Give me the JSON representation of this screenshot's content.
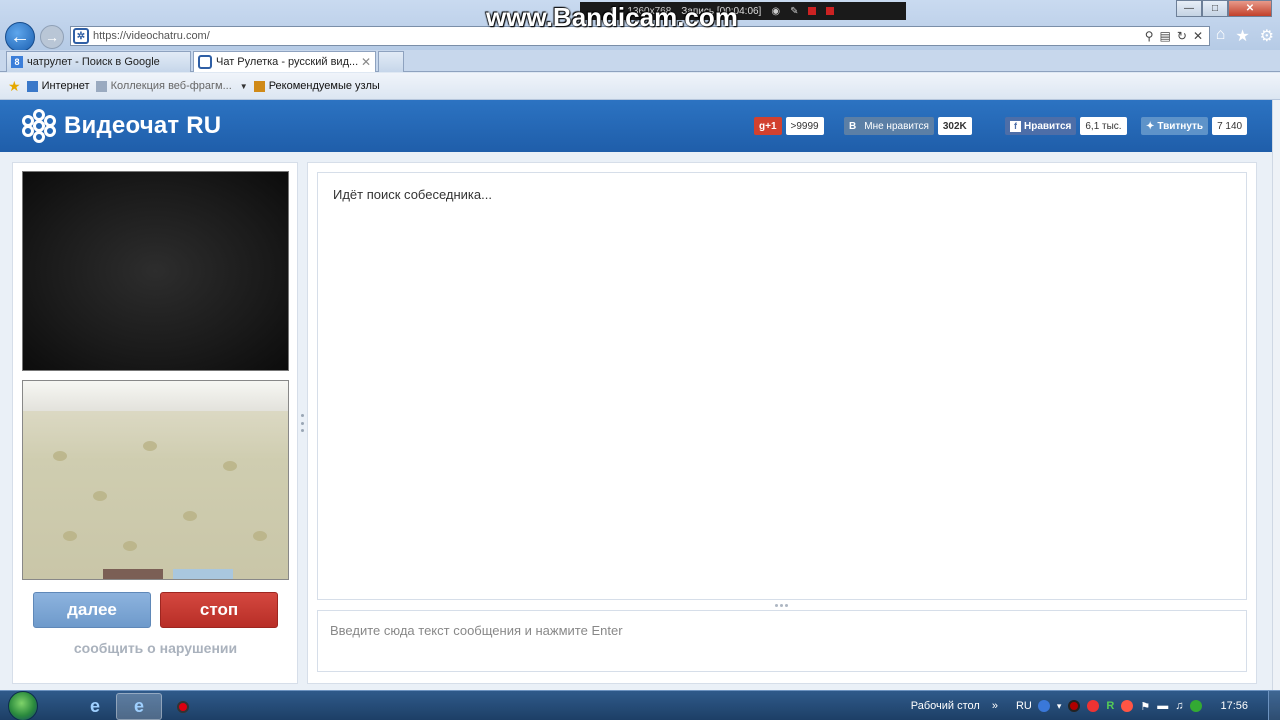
{
  "browser": {
    "url": "https://videochatru.com/",
    "tabs": [
      {
        "label": "чатрулет - Поиск в Google"
      },
      {
        "label": "Чат Рулетка - русский вид..."
      }
    ],
    "favorites": {
      "internet": "Интернет",
      "collection": "Коллекция веб-фрагм...",
      "recommended": "Рекомендуемые узлы"
    }
  },
  "recorder": {
    "watermark": "www.Bandicam.com",
    "resolution": "1360x768",
    "recording": "Запись [00:04:06]"
  },
  "site": {
    "title": "Видеочат RU",
    "social": {
      "gplus_label": "g+1",
      "gplus_count": ">9999",
      "vk_icon": "B",
      "vk_label": "Мне нравится",
      "vk_count": "302K",
      "fb_label": "Нравится",
      "fb_count": "6,1 тыс.",
      "tw_label": "Твитнуть",
      "tw_count": "7 140"
    }
  },
  "chat": {
    "status": "Идёт поиск собеседника...",
    "input_placeholder": "Введите сюда текст сообщения и нажмите Enter",
    "next_label": "далее",
    "stop_label": "стоп",
    "report_label": "сообщить о нарушении"
  },
  "taskbar": {
    "desktop_label": "Рабочий стол",
    "lang": "RU",
    "time": "17:56"
  },
  "colors": {
    "header_blue": "#2a6cb9",
    "next_button": "#7fa7d6",
    "stop_button": "#c63b33"
  }
}
